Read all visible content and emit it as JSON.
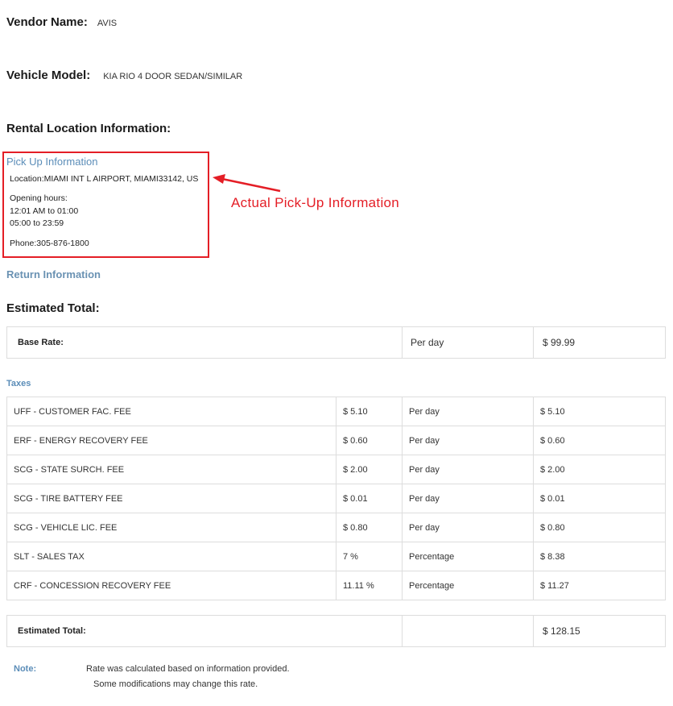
{
  "vendor": {
    "label": "Vendor Name:",
    "value": "AVIS"
  },
  "vehicle": {
    "label": "Vehicle Model:",
    "value": "KIA RIO 4 DOOR SEDAN/SIMILAR"
  },
  "rental_location": {
    "heading": "Rental Location Information:",
    "pickup": {
      "heading": "Pick Up Information",
      "location": "Location:MIAMI INT L AIRPORT, MIAMI33142, US",
      "hours_label": "Opening hours:",
      "hours": [
        "12:01 AM to 01:00",
        "05:00 to 23:59"
      ],
      "phone": "Phone:305-876-1800"
    },
    "return_heading": "Return Information"
  },
  "annotation": {
    "text": "Actual Pick-Up Information",
    "color": "#e41e26"
  },
  "estimated": {
    "heading": "Estimated Total:",
    "base_rate": {
      "label": "Base Rate:",
      "unit": "Per day",
      "amount": "$ 99.99"
    },
    "taxes_heading": "Taxes",
    "taxes": [
      {
        "name": "UFF - CUSTOMER FAC. FEE",
        "rate": "$ 5.10",
        "unit": "Per day",
        "amount": "$ 5.10"
      },
      {
        "name": "ERF - ENERGY RECOVERY FEE",
        "rate": "$ 0.60",
        "unit": "Per day",
        "amount": "$ 0.60"
      },
      {
        "name": "SCG - STATE SURCH. FEE",
        "rate": "$ 2.00",
        "unit": "Per day",
        "amount": "$ 2.00"
      },
      {
        "name": "SCG - TIRE BATTERY FEE",
        "rate": "$ 0.01",
        "unit": "Per day",
        "amount": "$ 0.01"
      },
      {
        "name": "SCG - VEHICLE LIC. FEE",
        "rate": "$ 0.80",
        "unit": "Per day",
        "amount": "$ 0.80"
      },
      {
        "name": "SLT - SALES TAX",
        "rate": "7 %",
        "unit": "Percentage",
        "amount": "$ 8.38"
      },
      {
        "name": "CRF - CONCESSION RECOVERY FEE",
        "rate": "11.11 %",
        "unit": "Percentage",
        "amount": "$ 11.27"
      }
    ],
    "total": {
      "label": "Estimated Total:",
      "amount": "$ 128.15"
    }
  },
  "note": {
    "label": "Note:",
    "line1": "Rate was calculated based on information provided.",
    "line2": "Some modifications may change this rate."
  },
  "colors": {
    "link": "#5b8db8",
    "highlight": "#e41e26",
    "border": "#dddddd"
  }
}
